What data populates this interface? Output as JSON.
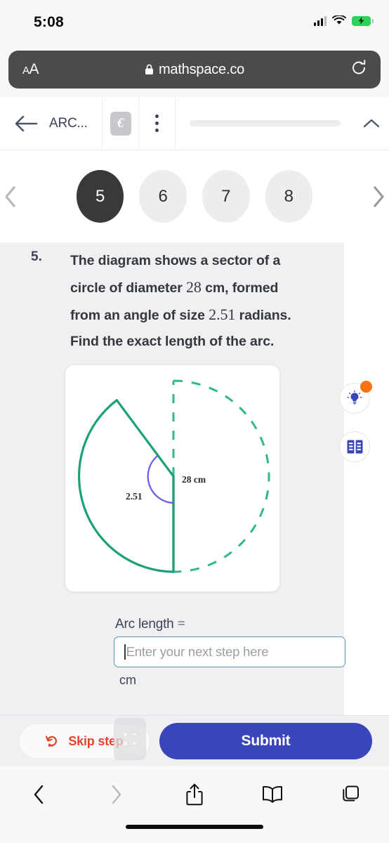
{
  "status_bar": {
    "time": "5:08",
    "signal_icon": "cellular-signal-icon",
    "wifi_icon": "wifi-icon",
    "battery_icon": "battery-charging-icon"
  },
  "browser": {
    "text_size_small": "A",
    "text_size_large": "A",
    "lock_icon": "lock-icon",
    "url": "mathspace.co",
    "reload_icon": "reload-icon",
    "bottom_toolbar": {
      "back_icon": "chevron-left-icon",
      "forward_icon": "chevron-right-icon",
      "share_icon": "share-icon",
      "bookmarks_icon": "book-icon",
      "tabs_icon": "tabs-icon"
    }
  },
  "app_header": {
    "back_icon": "arrow-left-icon",
    "title": "ARC...",
    "logo_icon": "mathspace-logo-icon",
    "more_icon": "more-vertical-icon",
    "collapse_icon": "chevron-up-icon"
  },
  "pager": {
    "prev_icon": "chevron-left-icon",
    "next_icon": "chevron-right-icon",
    "items": [
      {
        "label": "5",
        "active": true
      },
      {
        "label": "6",
        "active": false
      },
      {
        "label": "7",
        "active": false
      },
      {
        "label": "8",
        "active": false
      }
    ]
  },
  "question": {
    "number": "5.",
    "line1_a": "The diagram shows a sector of a",
    "line2_a": "circle of diameter ",
    "diameter": "28",
    "line2_b": " cm, formed",
    "line3_a": "from an angle of size ",
    "angle": "2.51",
    "line3_b": " radians.",
    "line4": "Find the exact length of the arc."
  },
  "diagram": {
    "name": "circle-sector-diagram",
    "radius_label": "28 cm",
    "angle_label": "2.51",
    "sector_color": "#22a884",
    "angle_arc_color": "#6c5ce7",
    "dashed_color": "#2fb78f",
    "angle_radians": 2.51,
    "diameter_cm": 28
  },
  "answer": {
    "label": "Arc length",
    "equals": "=",
    "input_value": "",
    "placeholder": "Enter your next step here",
    "unit": "cm"
  },
  "side_buttons": {
    "hint": {
      "icon": "lightbulb-icon",
      "has_badge": true,
      "badge_color": "#f97316"
    },
    "reference": {
      "icon": "reference-book-icon"
    }
  },
  "actions": {
    "skip_icon": "skip-step-icon",
    "skip_label": "Skip step",
    "math_keyboard_icon": "math-keyboard-icon",
    "math_keyboard_glyphs": [
      "+",
      "−",
      "×",
      "÷"
    ],
    "submit_label": "Submit"
  },
  "colors": {
    "accent_blue": "#3b45ba",
    "skip_red": "#e8432f",
    "teal": "#22a884",
    "purple": "#6c5ce7",
    "badge_orange": "#f97316",
    "input_border": "#5b93c4"
  }
}
